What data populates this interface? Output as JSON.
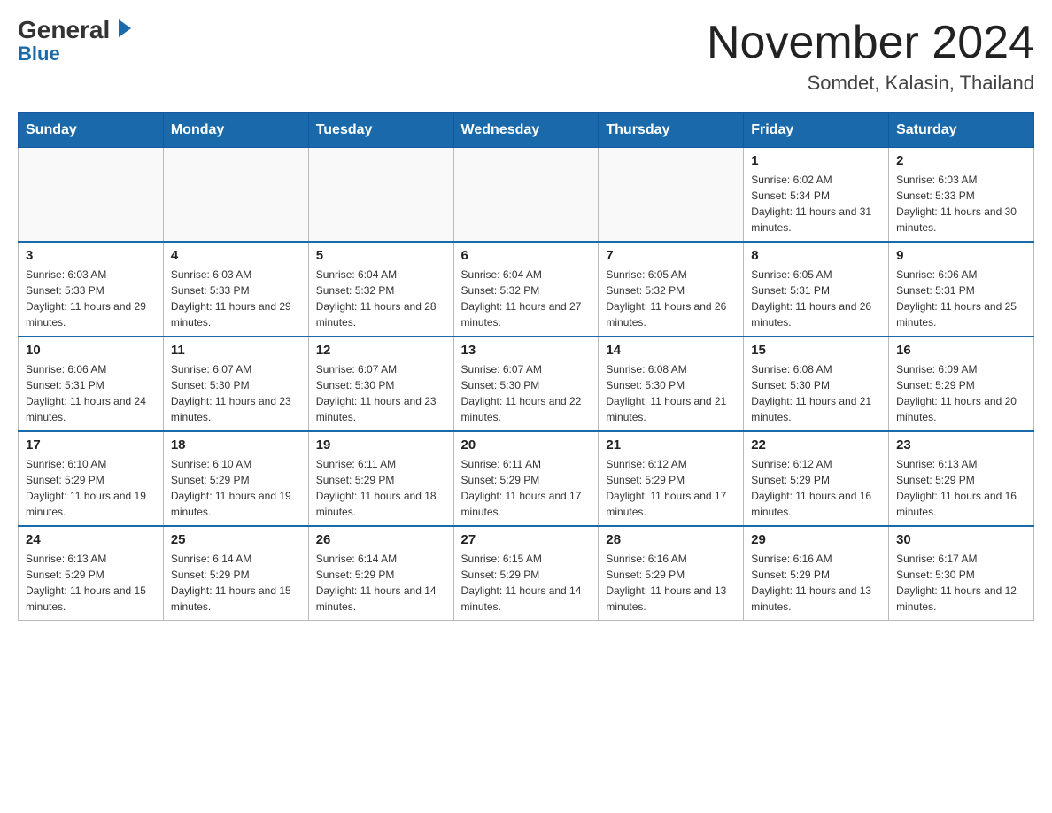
{
  "header": {
    "logo_general": "General",
    "logo_blue": "Blue",
    "month_year": "November 2024",
    "location": "Somdet, Kalasin, Thailand"
  },
  "weekdays": [
    "Sunday",
    "Monday",
    "Tuesday",
    "Wednesday",
    "Thursday",
    "Friday",
    "Saturday"
  ],
  "weeks": [
    [
      {
        "day": "",
        "info": ""
      },
      {
        "day": "",
        "info": ""
      },
      {
        "day": "",
        "info": ""
      },
      {
        "day": "",
        "info": ""
      },
      {
        "day": "",
        "info": ""
      },
      {
        "day": "1",
        "info": "Sunrise: 6:02 AM\nSunset: 5:34 PM\nDaylight: 11 hours and 31 minutes."
      },
      {
        "day": "2",
        "info": "Sunrise: 6:03 AM\nSunset: 5:33 PM\nDaylight: 11 hours and 30 minutes."
      }
    ],
    [
      {
        "day": "3",
        "info": "Sunrise: 6:03 AM\nSunset: 5:33 PM\nDaylight: 11 hours and 29 minutes."
      },
      {
        "day": "4",
        "info": "Sunrise: 6:03 AM\nSunset: 5:33 PM\nDaylight: 11 hours and 29 minutes."
      },
      {
        "day": "5",
        "info": "Sunrise: 6:04 AM\nSunset: 5:32 PM\nDaylight: 11 hours and 28 minutes."
      },
      {
        "day": "6",
        "info": "Sunrise: 6:04 AM\nSunset: 5:32 PM\nDaylight: 11 hours and 27 minutes."
      },
      {
        "day": "7",
        "info": "Sunrise: 6:05 AM\nSunset: 5:32 PM\nDaylight: 11 hours and 26 minutes."
      },
      {
        "day": "8",
        "info": "Sunrise: 6:05 AM\nSunset: 5:31 PM\nDaylight: 11 hours and 26 minutes."
      },
      {
        "day": "9",
        "info": "Sunrise: 6:06 AM\nSunset: 5:31 PM\nDaylight: 11 hours and 25 minutes."
      }
    ],
    [
      {
        "day": "10",
        "info": "Sunrise: 6:06 AM\nSunset: 5:31 PM\nDaylight: 11 hours and 24 minutes."
      },
      {
        "day": "11",
        "info": "Sunrise: 6:07 AM\nSunset: 5:30 PM\nDaylight: 11 hours and 23 minutes."
      },
      {
        "day": "12",
        "info": "Sunrise: 6:07 AM\nSunset: 5:30 PM\nDaylight: 11 hours and 23 minutes."
      },
      {
        "day": "13",
        "info": "Sunrise: 6:07 AM\nSunset: 5:30 PM\nDaylight: 11 hours and 22 minutes."
      },
      {
        "day": "14",
        "info": "Sunrise: 6:08 AM\nSunset: 5:30 PM\nDaylight: 11 hours and 21 minutes."
      },
      {
        "day": "15",
        "info": "Sunrise: 6:08 AM\nSunset: 5:30 PM\nDaylight: 11 hours and 21 minutes."
      },
      {
        "day": "16",
        "info": "Sunrise: 6:09 AM\nSunset: 5:29 PM\nDaylight: 11 hours and 20 minutes."
      }
    ],
    [
      {
        "day": "17",
        "info": "Sunrise: 6:10 AM\nSunset: 5:29 PM\nDaylight: 11 hours and 19 minutes."
      },
      {
        "day": "18",
        "info": "Sunrise: 6:10 AM\nSunset: 5:29 PM\nDaylight: 11 hours and 19 minutes."
      },
      {
        "day": "19",
        "info": "Sunrise: 6:11 AM\nSunset: 5:29 PM\nDaylight: 11 hours and 18 minutes."
      },
      {
        "day": "20",
        "info": "Sunrise: 6:11 AM\nSunset: 5:29 PM\nDaylight: 11 hours and 17 minutes."
      },
      {
        "day": "21",
        "info": "Sunrise: 6:12 AM\nSunset: 5:29 PM\nDaylight: 11 hours and 17 minutes."
      },
      {
        "day": "22",
        "info": "Sunrise: 6:12 AM\nSunset: 5:29 PM\nDaylight: 11 hours and 16 minutes."
      },
      {
        "day": "23",
        "info": "Sunrise: 6:13 AM\nSunset: 5:29 PM\nDaylight: 11 hours and 16 minutes."
      }
    ],
    [
      {
        "day": "24",
        "info": "Sunrise: 6:13 AM\nSunset: 5:29 PM\nDaylight: 11 hours and 15 minutes."
      },
      {
        "day": "25",
        "info": "Sunrise: 6:14 AM\nSunset: 5:29 PM\nDaylight: 11 hours and 15 minutes."
      },
      {
        "day": "26",
        "info": "Sunrise: 6:14 AM\nSunset: 5:29 PM\nDaylight: 11 hours and 14 minutes."
      },
      {
        "day": "27",
        "info": "Sunrise: 6:15 AM\nSunset: 5:29 PM\nDaylight: 11 hours and 14 minutes."
      },
      {
        "day": "28",
        "info": "Sunrise: 6:16 AM\nSunset: 5:29 PM\nDaylight: 11 hours and 13 minutes."
      },
      {
        "day": "29",
        "info": "Sunrise: 6:16 AM\nSunset: 5:29 PM\nDaylight: 11 hours and 13 minutes."
      },
      {
        "day": "30",
        "info": "Sunrise: 6:17 AM\nSunset: 5:30 PM\nDaylight: 11 hours and 12 minutes."
      }
    ]
  ]
}
